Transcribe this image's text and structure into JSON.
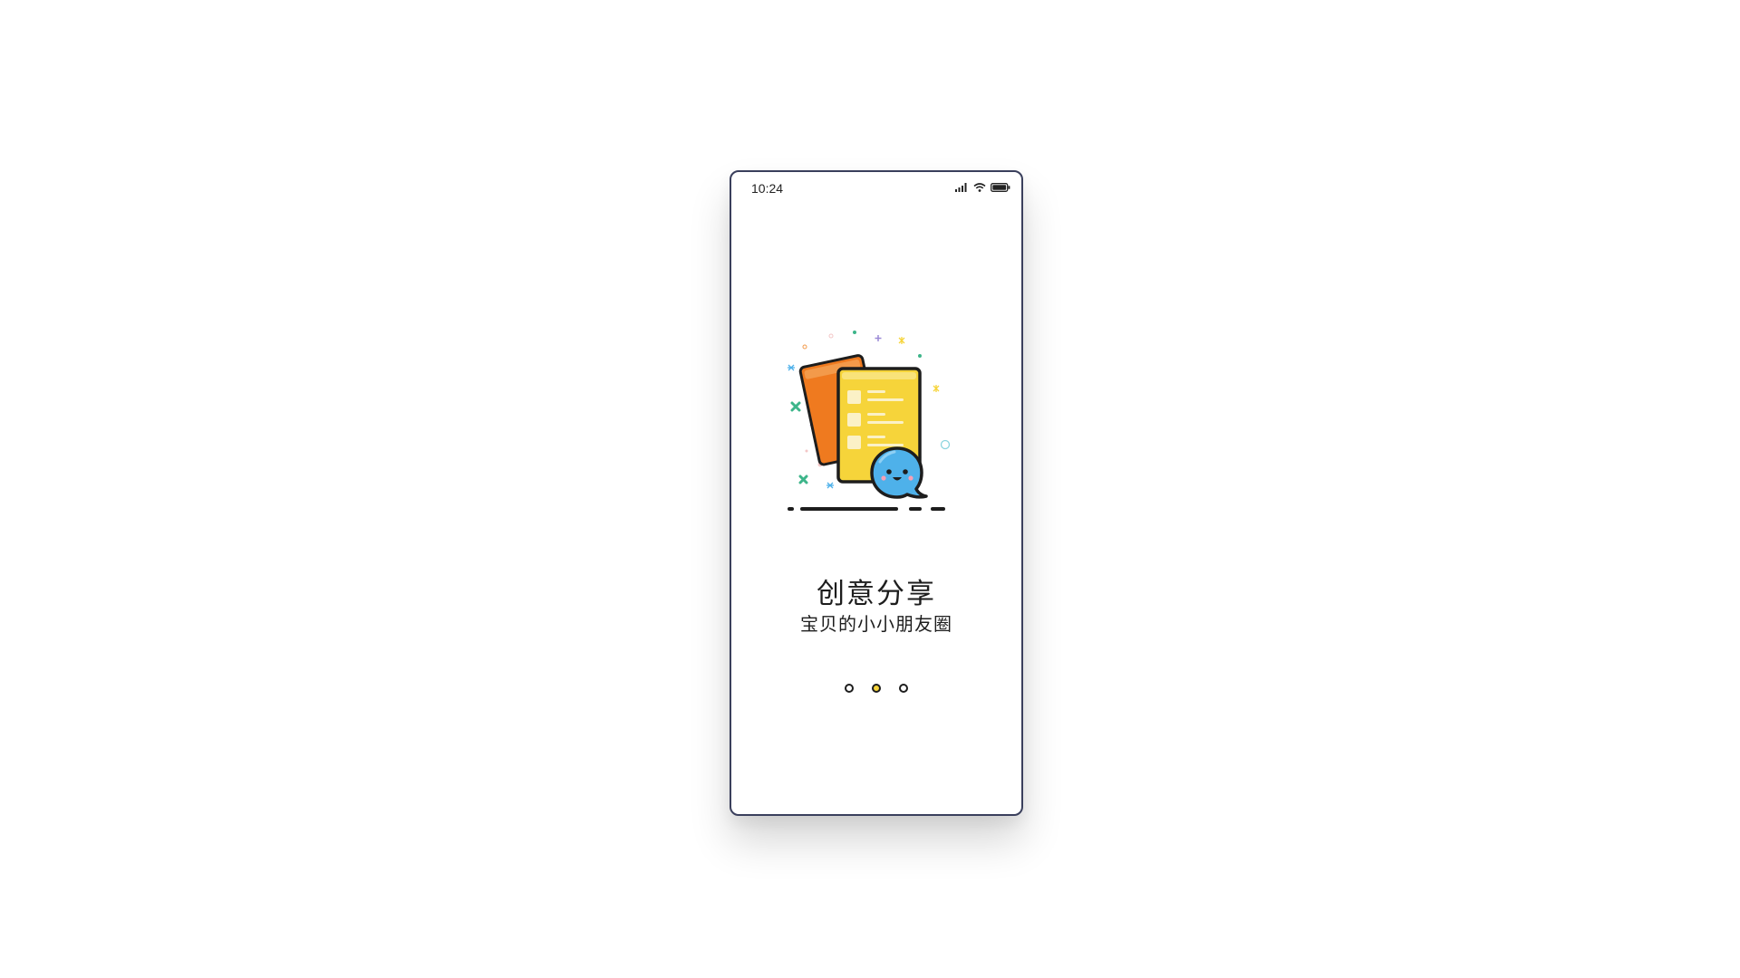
{
  "status_bar": {
    "time": "10:24",
    "icons": [
      "signal-icon",
      "wifi-icon",
      "battery-icon"
    ]
  },
  "onboarding": {
    "illustration": "documents-chat-bubble-illustration",
    "title": "创意分享",
    "subtitle": "宝贝的小小朋友圈"
  },
  "pagination": {
    "total": 3,
    "active_index": 1
  },
  "colors": {
    "accent_yellow": "#f6d43a",
    "orange_card": "#ef7a1f",
    "bubble_blue": "#4eb1ea",
    "frame": "#3a3f5c"
  }
}
